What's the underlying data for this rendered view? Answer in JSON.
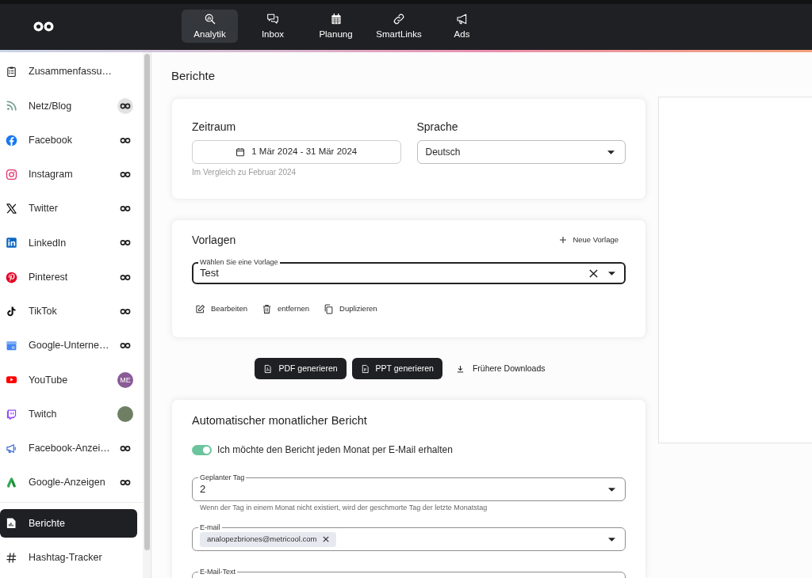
{
  "nav": [
    {
      "label": "Analytik",
      "selected": true
    },
    {
      "label": "Inbox",
      "selected": false
    },
    {
      "label": "Planung",
      "selected": false
    },
    {
      "label": "SmartLinks",
      "selected": false
    },
    {
      "label": "Ads",
      "selected": false
    }
  ],
  "sidebar": {
    "networks": [
      {
        "label": "Zusammenfassu…",
        "selected": false
      },
      {
        "label": "Netz/Blog",
        "selected": false,
        "badge": {
          "kind": "link",
          "highlighted": true
        }
      },
      {
        "label": "Facebook",
        "selected": false,
        "badge": {
          "kind": "link",
          "highlighted": false
        }
      },
      {
        "label": "Instagram",
        "selected": false,
        "badge": {
          "kind": "link",
          "highlighted": false
        }
      },
      {
        "label": "Twitter",
        "selected": false,
        "badge": {
          "kind": "link",
          "highlighted": false
        }
      },
      {
        "label": "LinkedIn",
        "selected": false,
        "badge": {
          "kind": "link",
          "highlighted": false
        }
      },
      {
        "label": "Pinterest",
        "selected": false,
        "badge": {
          "kind": "link",
          "highlighted": false
        }
      },
      {
        "label": "TikTok",
        "selected": false,
        "badge": {
          "kind": "link",
          "highlighted": false
        }
      },
      {
        "label": "Google-Unterne…",
        "selected": false,
        "badge": {
          "kind": "link",
          "highlighted": false
        }
      },
      {
        "label": "YouTube",
        "selected": false,
        "badge": {
          "kind": "initials",
          "text": "ME"
        }
      },
      {
        "label": "Twitch",
        "selected": false,
        "badge": {
          "kind": "photo"
        }
      },
      {
        "label": "Facebook-Anzei…",
        "selected": false,
        "badge": {
          "kind": "link",
          "highlighted": false
        }
      },
      {
        "label": "Google-Anzeigen",
        "selected": false,
        "badge": {
          "kind": "link",
          "highlighted": false
        }
      }
    ],
    "tools": [
      {
        "label": "Berichte",
        "selected": true
      },
      {
        "label": "Hashtag-Tracker",
        "selected": false
      }
    ]
  },
  "page_title": "Berichte",
  "period_card": {
    "period": {
      "label": "Zeitraum",
      "value": "1 Mär 2024 - 31 Mär 2024",
      "comparison": "Im Vergleich zu Februar 2024"
    },
    "language": {
      "label": "Sprache",
      "value": "Deutsch"
    }
  },
  "templates_card": {
    "title": "Vorlagen",
    "new_button": "Neue Vorlage",
    "select": {
      "label": "Wählen Sie eine Vorlage",
      "value": "Test"
    },
    "actions": [
      "Bearbeiten",
      "entfernen",
      "Duplizieren"
    ]
  },
  "export_buttons": [
    {
      "label": "PDF generieren",
      "kind": "primary"
    },
    {
      "label": "PPT generieren",
      "kind": "primary"
    },
    {
      "label": "Frühere Downloads",
      "kind": "text"
    }
  ],
  "auto_report": {
    "title": "Automatischer monatlicher Bericht",
    "toggle": {
      "label": "Ich möchte den Bericht jeden Monat per E-Mail erhalten",
      "on": true
    },
    "day_field": {
      "label": "Geplanter Tag",
      "value": "2",
      "helper_text": "Wenn der Tag in einem Monat nicht existiert, wird der geschmorte Tag der letzte Monatstag"
    },
    "email_field": {
      "label": "E-mail",
      "chips": [
        "analopezbriones@metricool.com"
      ]
    },
    "text_field": {
      "label": "E-Mail-Text"
    }
  }
}
